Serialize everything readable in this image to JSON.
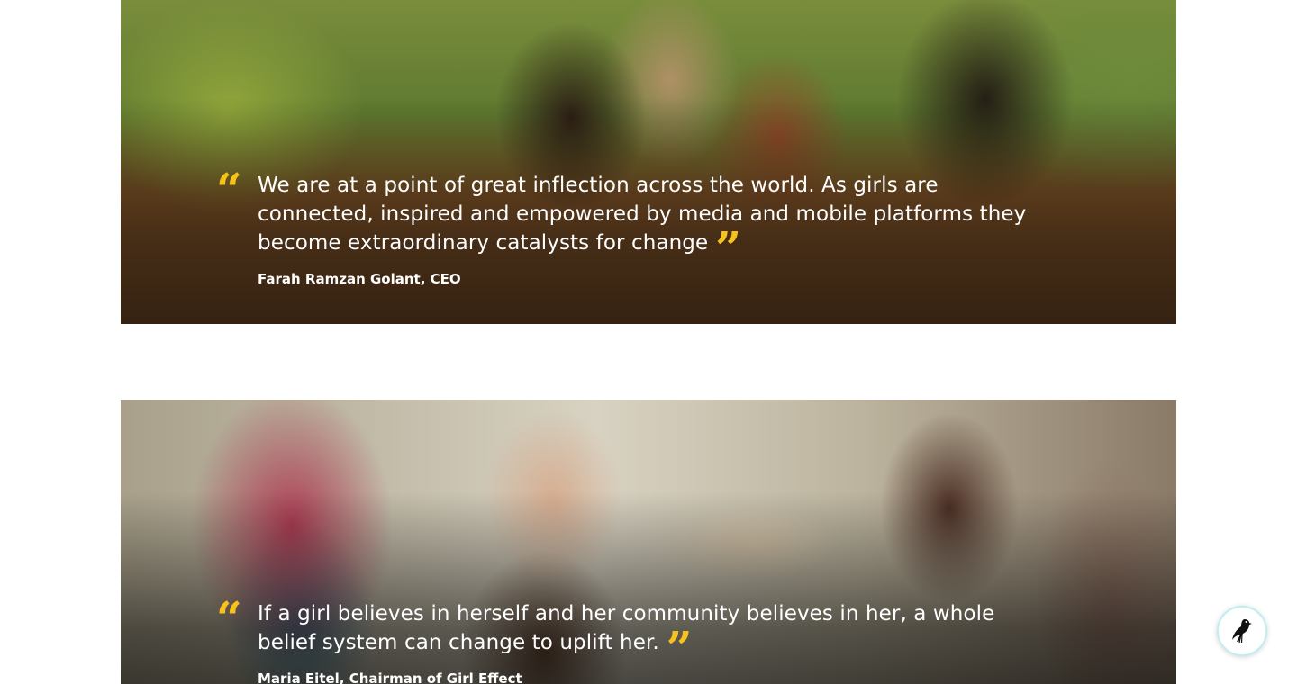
{
  "quotes": [
    {
      "open_mark": "“",
      "text": "We are at a point of great inflection across the world. As girls are connected, inspired and empowered by media and mobile platforms they become extraordinary catalysts for change",
      "close_mark": "”",
      "attribution": "Farah Ramzan Golant, CEO"
    },
    {
      "open_mark": "“",
      "text": "If a girl believes in herself and her community believes in her, a whole belief system can change to uplift her.",
      "close_mark": "”",
      "attribution": "Maria Eitel, Chairman of Girl Effect"
    }
  ],
  "floating_button": {
    "icon": "bird-icon"
  },
  "colors": {
    "quote_mark": "#f7c21b",
    "text": "#ffffff",
    "button_border": "#bfeff0"
  }
}
